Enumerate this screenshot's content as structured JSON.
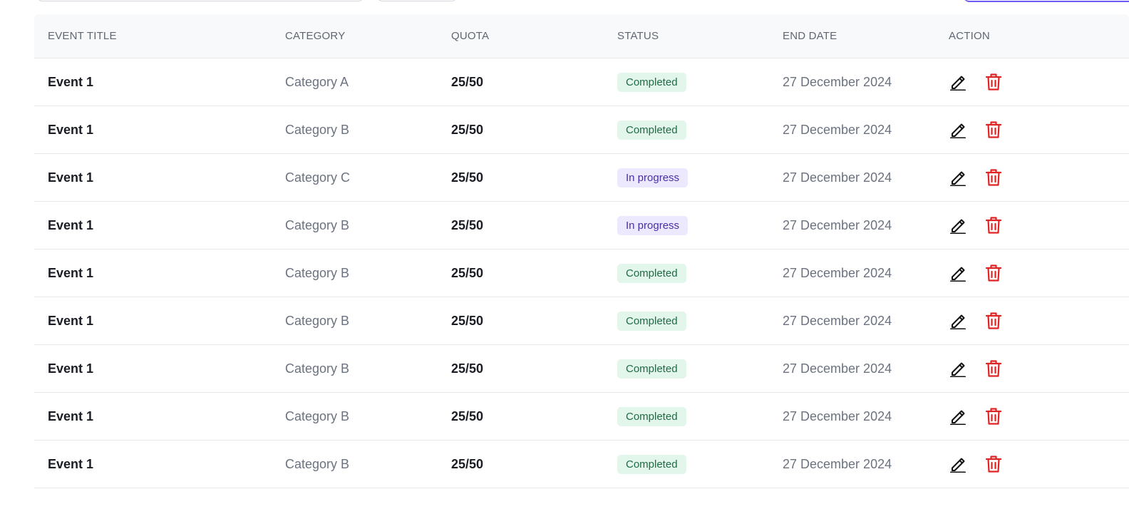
{
  "colors": {
    "completed_bg": "#e3f6eb",
    "completed_text": "#1e6b45",
    "in_progress_bg": "#ece8fd",
    "in_progress_text": "#4a2fa8",
    "delete_icon": "#e02424",
    "edit_icon": "#111111",
    "header_bg": "#f8f9fb"
  },
  "table": {
    "headers": {
      "event_title": "EVENT TITLE",
      "category": "CATEGORY",
      "quota": "QUOTA",
      "status": "STATUS",
      "end_date": "END DATE",
      "action": "ACTION"
    },
    "rows": [
      {
        "title": "Event 1",
        "category": "Category A",
        "quota": "25/50",
        "status": "Completed",
        "status_kind": "completed",
        "end_date": "27 December 2024"
      },
      {
        "title": "Event 1",
        "category": "Category B",
        "quota": "25/50",
        "status": "Completed",
        "status_kind": "completed",
        "end_date": "27 December 2024"
      },
      {
        "title": "Event 1",
        "category": "Category C",
        "quota": "25/50",
        "status": "In progress",
        "status_kind": "progress",
        "end_date": "27 December 2024"
      },
      {
        "title": "Event 1",
        "category": "Category B",
        "quota": "25/50",
        "status": "In progress",
        "status_kind": "progress",
        "end_date": "27 December 2024"
      },
      {
        "title": "Event 1",
        "category": "Category B",
        "quota": "25/50",
        "status": "Completed",
        "status_kind": "completed",
        "end_date": "27 December 2024"
      },
      {
        "title": "Event 1",
        "category": "Category B",
        "quota": "25/50",
        "status": "Completed",
        "status_kind": "completed",
        "end_date": "27 December 2024"
      },
      {
        "title": "Event 1",
        "category": "Category B",
        "quota": "25/50",
        "status": "Completed",
        "status_kind": "completed",
        "end_date": "27 December 2024"
      },
      {
        "title": "Event 1",
        "category": "Category B",
        "quota": "25/50",
        "status": "Completed",
        "status_kind": "completed",
        "end_date": "27 December 2024"
      },
      {
        "title": "Event 1",
        "category": "Category B",
        "quota": "25/50",
        "status": "Completed",
        "status_kind": "completed",
        "end_date": "27 December 2024"
      }
    ],
    "row_actions": [
      {
        "icon": "pencil-edit-icon"
      },
      {
        "icon": "trash-delete-icon"
      }
    ]
  }
}
